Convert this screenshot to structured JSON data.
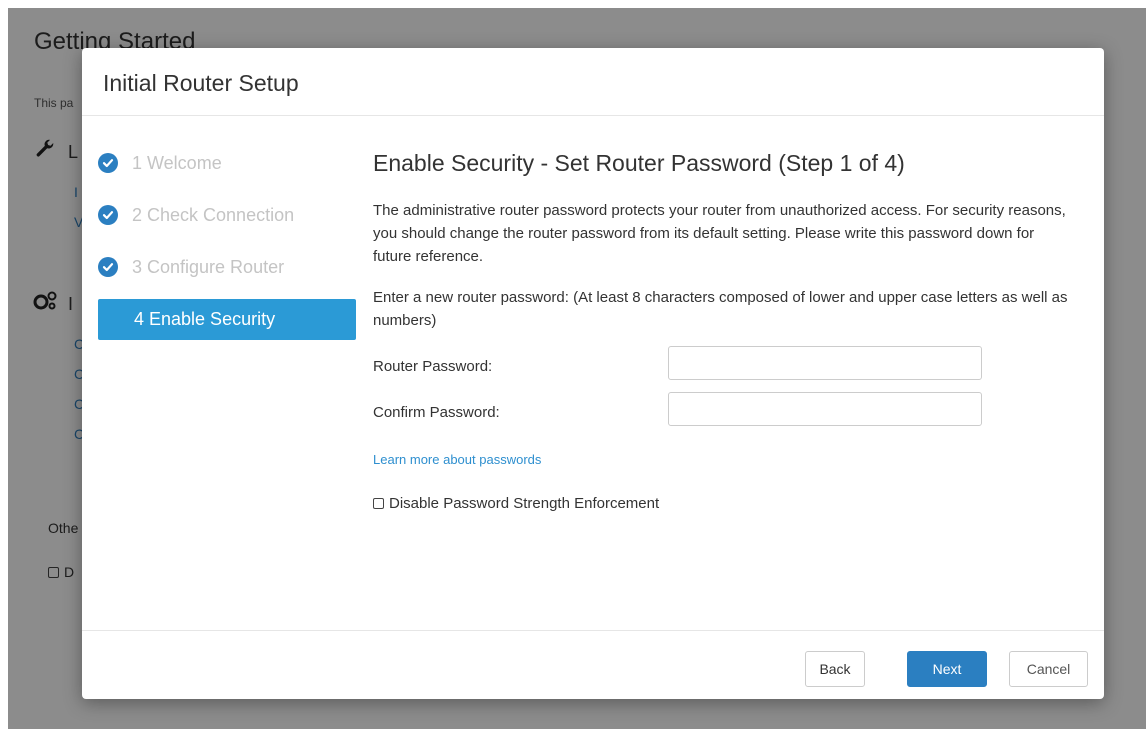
{
  "background": {
    "title": "Getting Started",
    "description_fragment": "This pa",
    "section1_fragment": "L",
    "section1_links": [
      "I",
      "V"
    ],
    "section2_fragment": "I",
    "section2_links": [
      "C",
      "C",
      "C",
      "C"
    ],
    "other_fragment": "Othe",
    "checkbox_fragment": "D"
  },
  "modal": {
    "title": "Initial Router Setup",
    "steps": [
      {
        "label": "1 Welcome",
        "state": "done"
      },
      {
        "label": "2 Check Connection",
        "state": "done"
      },
      {
        "label": "3 Configure Router",
        "state": "done"
      },
      {
        "label": "4 Enable Security",
        "state": "active"
      }
    ],
    "heading": "Enable Security - Set Router Password (Step 1 of 4)",
    "intro": "The administrative router password protects your router from unauthorized access. For security reasons, you should change the router password from its default setting. Please write this password down for future reference.",
    "requirement": "Enter a new router password: (At least 8 characters composed of lower and upper case letters as well as numbers)",
    "fields": {
      "router_password": {
        "label": "Router Password:",
        "value": ""
      },
      "confirm_password": {
        "label": "Confirm Password:",
        "value": ""
      }
    },
    "learn_more": "Learn more about passwords",
    "disable_enforcement": {
      "label": "Disable Password Strength Enforcement",
      "checked": false
    },
    "buttons": {
      "back": "Back",
      "next": "Next",
      "cancel": "Cancel"
    }
  },
  "colors": {
    "accent": "#2b7fc1",
    "active_step": "#2b9ad6",
    "link": "#2e8fcf"
  },
  "icons": {
    "step_done": "check-circle-icon",
    "section1": "wrench-icon",
    "section2": "gears-icon"
  }
}
